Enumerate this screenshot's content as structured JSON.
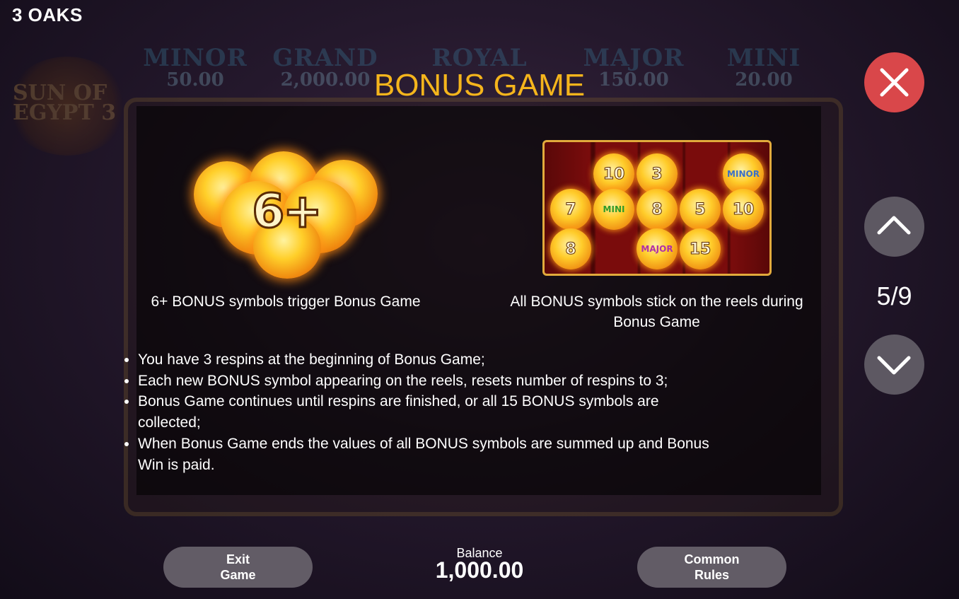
{
  "brand": "3 OAKS",
  "background": {
    "logo_text": "SUN OF EGYPT 3",
    "jackpots": [
      {
        "name": "MINOR",
        "value": "50.00"
      },
      {
        "name": "GRAND",
        "value": "2,000.00"
      },
      {
        "name": "ROYAL",
        "value": ""
      },
      {
        "name": "MAJOR",
        "value": "150.00"
      },
      {
        "name": "MINI",
        "value": "20.00"
      }
    ]
  },
  "page": {
    "title": "BONUS GAME",
    "trigger_symbol": "6+",
    "left_caption": "6+ BONUS symbols trigger Bonus Game",
    "right_caption_line1": "All BONUS symbols stick on the reels during",
    "right_caption_line2": "Bonus Game",
    "grid_coins": [
      "10",
      "3",
      "MINOR",
      "7",
      "MINI",
      "8",
      "5",
      "10",
      "8",
      "MAJOR",
      "15"
    ],
    "rules": [
      "You have 3 respins at the beginning of Bonus Game;",
      "Each new BONUS symbol appearing on the reels, resets number of respins to 3;",
      "Bonus Game continues until respins are finished, or all 15 BONUS symbols are collected;",
      "When Bonus Game ends the values of all BONUS symbols are summed up and Bonus Win is paid."
    ]
  },
  "pagination": {
    "current": 5,
    "total": 9,
    "label": "5/9"
  },
  "controls": {
    "close_icon": "close-icon",
    "up_icon": "chevron-up-icon",
    "down_icon": "chevron-down-icon"
  },
  "footer": {
    "exit_line1": "Exit",
    "exit_line2": "Game",
    "balance_label": "Balance",
    "balance_value": "1,000.00",
    "rules_line1": "Common",
    "rules_line2": "Rules"
  },
  "colors": {
    "title": "#f5b51c",
    "close_button": "#d9474a",
    "nav_button": "#5d5862",
    "pill_button": "#625c66"
  }
}
